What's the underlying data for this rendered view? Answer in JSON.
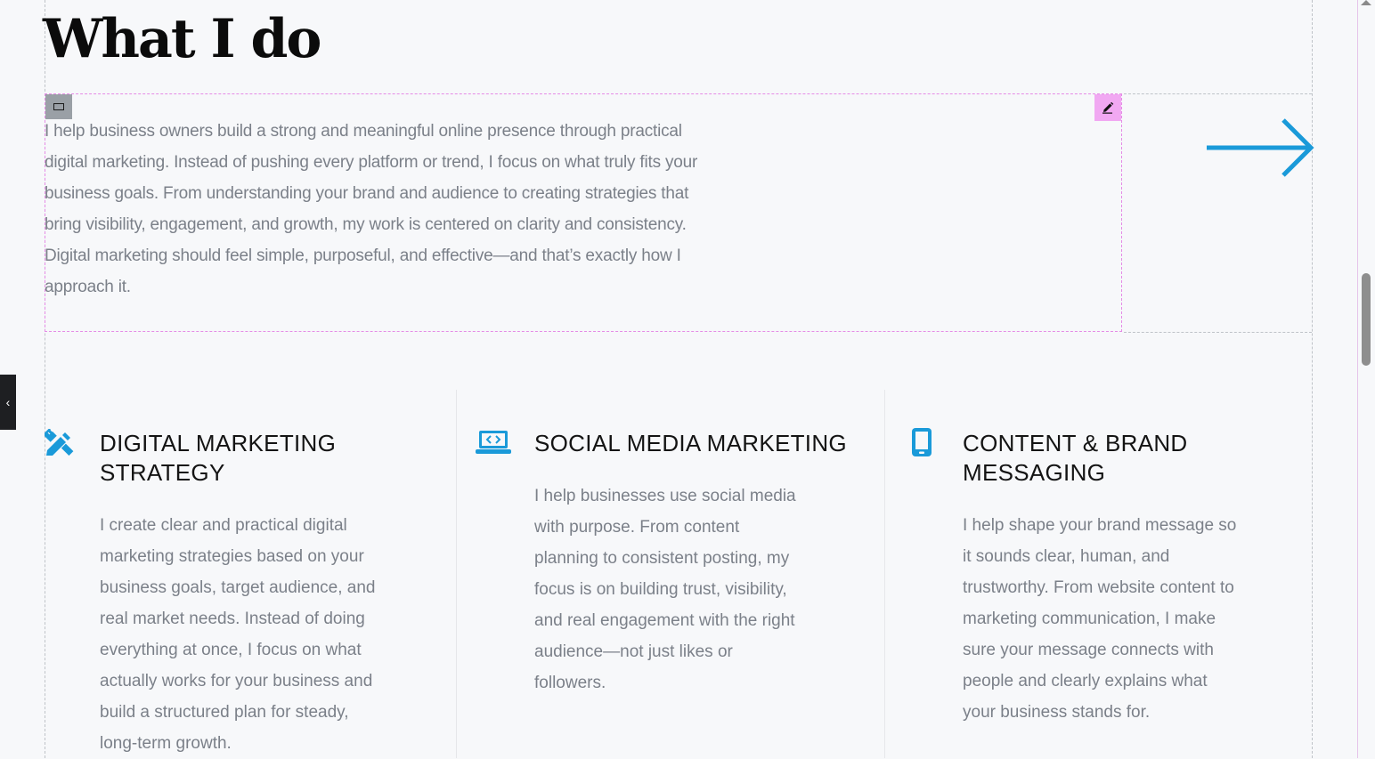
{
  "section": {
    "heading": "What I do",
    "intro": "I help business owners build a strong and meaningful online presence through practical digital marketing. Instead of pushing every platform or trend, I focus on what truly fits your business goals. From understanding your brand and audience to creating strategies that bring visibility, engagement, and growth, my work is centered on clarity and consistency. Digital marketing should feel simple, purposeful, and effective—and that’s exactly how I approach it."
  },
  "colors": {
    "accent": "#1a9ad9",
    "heading": "#0b0b0b",
    "body_text": "#7b8089",
    "widget_outline": "#e58be6",
    "edit_button": "#f1a8f2"
  },
  "icons": {
    "arrow": "arrow-right-icon",
    "widget_handle": "rectangle-icon",
    "edit": "pencil-icon",
    "side_toggle": "chevron-left-icon"
  },
  "side_toggle": {
    "glyph": "‹"
  },
  "services": [
    {
      "icon": "pencil-ruler-icon",
      "title": "DIGITAL MARKETING STRATEGY",
      "description": "I create clear and practical digital marketing strategies based on your business goals, target audience, and real market needs. Instead of doing everything at once, I focus on what actually works for your business and build a structured plan for steady, long-term growth."
    },
    {
      "icon": "laptop-code-icon",
      "title": "SOCIAL MEDIA MARKETING",
      "description": "I help businesses use social media with purpose. From content planning to consistent posting, my focus is on building trust, visibility, and real engagement with the right audience—not just likes or followers."
    },
    {
      "icon": "mobile-phone-icon",
      "title": "CONTENT & BRAND MESSAGING",
      "description": "I help shape your brand message so it sounds clear, human, and trustworthy. From website content to marketing communication, I make sure your message connects with people and clearly explains what your business stands for."
    }
  ]
}
